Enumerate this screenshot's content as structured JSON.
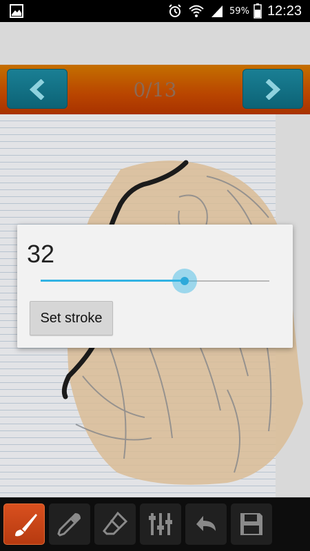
{
  "status_bar": {
    "battery_percent": "59%",
    "time": "12:23",
    "icons": [
      "gallery-icon",
      "alarm-icon",
      "wifi-icon",
      "signal-icon",
      "battery-icon"
    ]
  },
  "navigation": {
    "page_counter": "0/13",
    "prev_icon": "chevron-left-icon",
    "next_icon": "chevron-right-icon"
  },
  "stroke_dialog": {
    "value": "32",
    "slider_fraction": 0.63,
    "button_label": "Set stroke"
  },
  "toolbar": {
    "tools": [
      {
        "name": "brush",
        "icon": "brush-icon",
        "active": true
      },
      {
        "name": "eyedropper",
        "icon": "eyedropper-icon",
        "active": false
      },
      {
        "name": "eraser",
        "icon": "eraser-icon",
        "active": false
      },
      {
        "name": "settings",
        "icon": "sliders-icon",
        "active": false
      },
      {
        "name": "undo",
        "icon": "undo-icon",
        "active": false
      },
      {
        "name": "save",
        "icon": "save-icon",
        "active": false
      }
    ]
  },
  "colors": {
    "accent": "#33b5e5",
    "active_tool": "#c9461a",
    "nav_button": "#127286",
    "navbar": "#b84a00"
  }
}
